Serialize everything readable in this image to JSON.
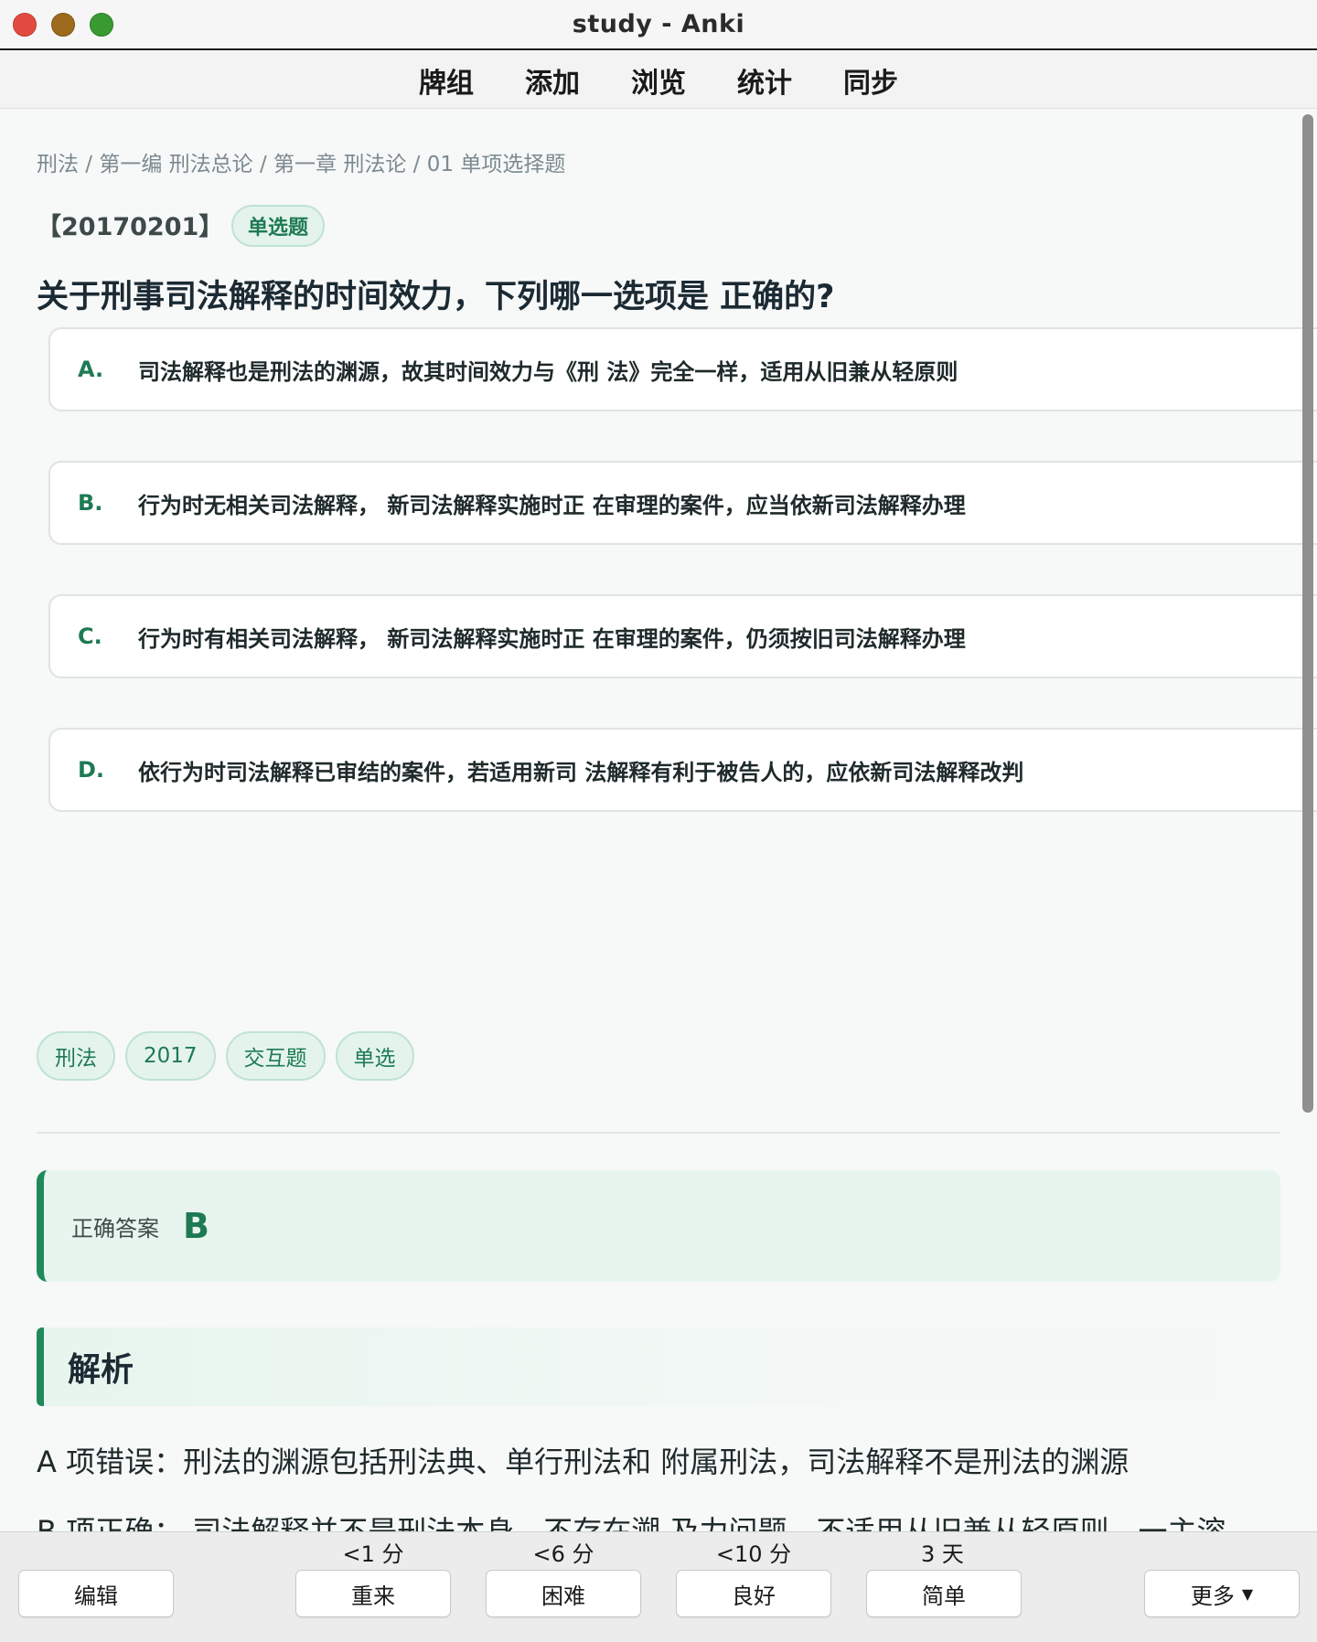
{
  "window": {
    "title": "study - Anki"
  },
  "nav": {
    "items": [
      "牌组",
      "添加",
      "浏览",
      "统计",
      "同步"
    ]
  },
  "card": {
    "breadcrumb": "刑法 / 第一编 刑法总论 / 第一章 刑法论 / 01 单项选择题",
    "id": "【20170201】",
    "type": "单选题",
    "question": "关于刑事司法解释的时间效力，下列哪一选项是 正确的?",
    "options": [
      {
        "letter": "A.",
        "text": "司法解释也是刑法的渊源，故其时间效力与《刑 法》完全一样，适用从旧兼从轻原则"
      },
      {
        "letter": "B.",
        "text": "行为时无相关司法解释， 新司法解释实施时正 在审理的案件，应当依新司法解释办理"
      },
      {
        "letter": "C.",
        "text": "行为时有相关司法解释， 新司法解释实施时正 在审理的案件，仍须按旧司法解释办理"
      },
      {
        "letter": "D.",
        "text": "依行为时司法解释已审结的案件，若适用新司 法解释有利于被告人的，应依新司法解释改判"
      }
    ],
    "tags": [
      "刑法",
      "2017",
      "交互题",
      "单选"
    ],
    "answer": {
      "label": "正确答案",
      "value": "B"
    },
    "analysis": {
      "heading": "解析",
      "p1": "A 项错误：刑法的渊源包括刑法典、单行刑法和 附属刑法，司法解释不是刑法的渊源",
      "p2": "B 项正确： 司法解释并不是刑法本身，不存在溯 及力问题，不适用从旧兼从轻原则，一主溶"
    }
  },
  "bottom": {
    "edit": "编辑",
    "answers": [
      {
        "interval": "<1 分",
        "label": "重来"
      },
      {
        "interval": "<6 分",
        "label": "困难"
      },
      {
        "interval": "<10 分",
        "label": "良好"
      },
      {
        "interval": "3 天",
        "label": "简单"
      }
    ],
    "more": "更多"
  }
}
